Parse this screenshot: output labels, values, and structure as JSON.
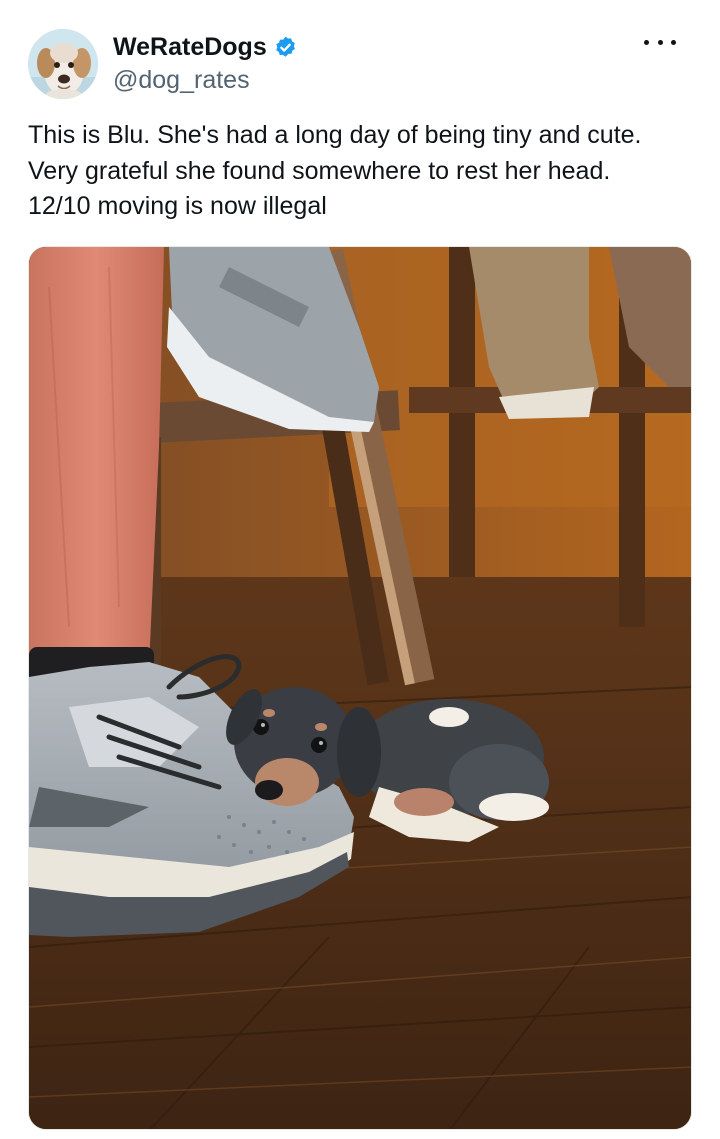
{
  "tweet": {
    "author": {
      "display_name": "WeRateDogs",
      "handle": "@dog_rates",
      "verified": true,
      "avatar_icon": "dog-avatar"
    },
    "more_icon": "more-options-icon",
    "text_lines": [
      "This is Blu. She's had a long day of being tiny and cute.",
      "Very grateful she found somewhere to rest her head.",
      "12/10 moving is now illegal"
    ],
    "media": {
      "type": "photo",
      "subject": "small dachshund puppy resting its head on a grey sneaker on a wooden floor"
    }
  },
  "colors": {
    "verified_badge": "#1d9bf0",
    "text_primary": "#0f1419",
    "text_secondary": "#536471"
  }
}
